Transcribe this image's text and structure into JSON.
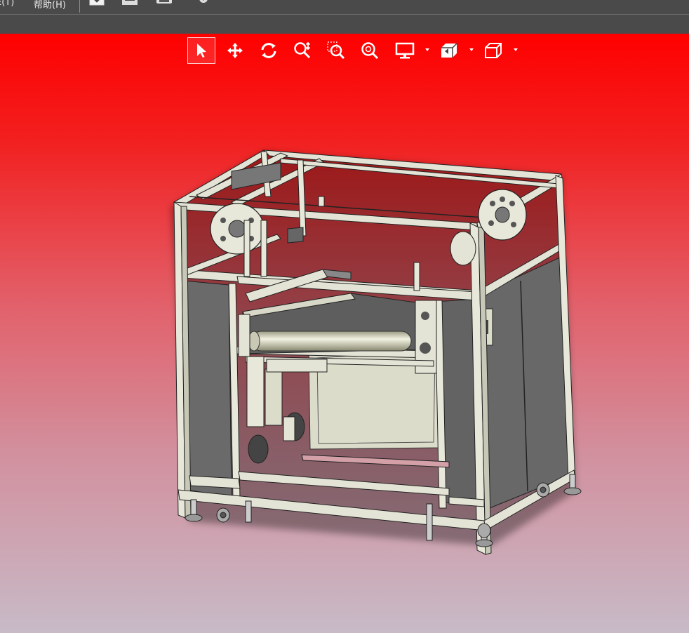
{
  "menubar": {
    "items": [
      {
        "label": "E(T)"
      },
      {
        "label": "帮助(H)"
      }
    ],
    "toolbar_icons": [
      "save-check-icon",
      "save-icon",
      "print-icon",
      "settings-icon"
    ]
  },
  "view_toolbar": {
    "tools": [
      {
        "name": "select",
        "icon": "pointer-icon",
        "active": true
      },
      {
        "name": "pan",
        "icon": "move-arrows-icon"
      },
      {
        "name": "rotate",
        "icon": "rotate-icon"
      },
      {
        "name": "zoom-in-out",
        "icon": "zoom-in-out-icon"
      },
      {
        "name": "zoom-window",
        "icon": "zoom-window-icon"
      },
      {
        "name": "zoom-to-fit",
        "icon": "zoom-fit-icon"
      },
      {
        "name": "display-style",
        "icon": "monitor-icon",
        "dropdown": true
      },
      {
        "name": "view-orientation",
        "icon": "view-orient-icon",
        "dropdown": true
      },
      {
        "name": "standard-views",
        "icon": "cube-icon",
        "dropdown": true
      }
    ]
  },
  "viewport": {
    "background_top": "#ff0000",
    "background_bottom": "#c8bac7",
    "model": "machine-frame-assembly",
    "frame_color": "#e4e4d6",
    "panel_color": "#6a6a6a"
  }
}
